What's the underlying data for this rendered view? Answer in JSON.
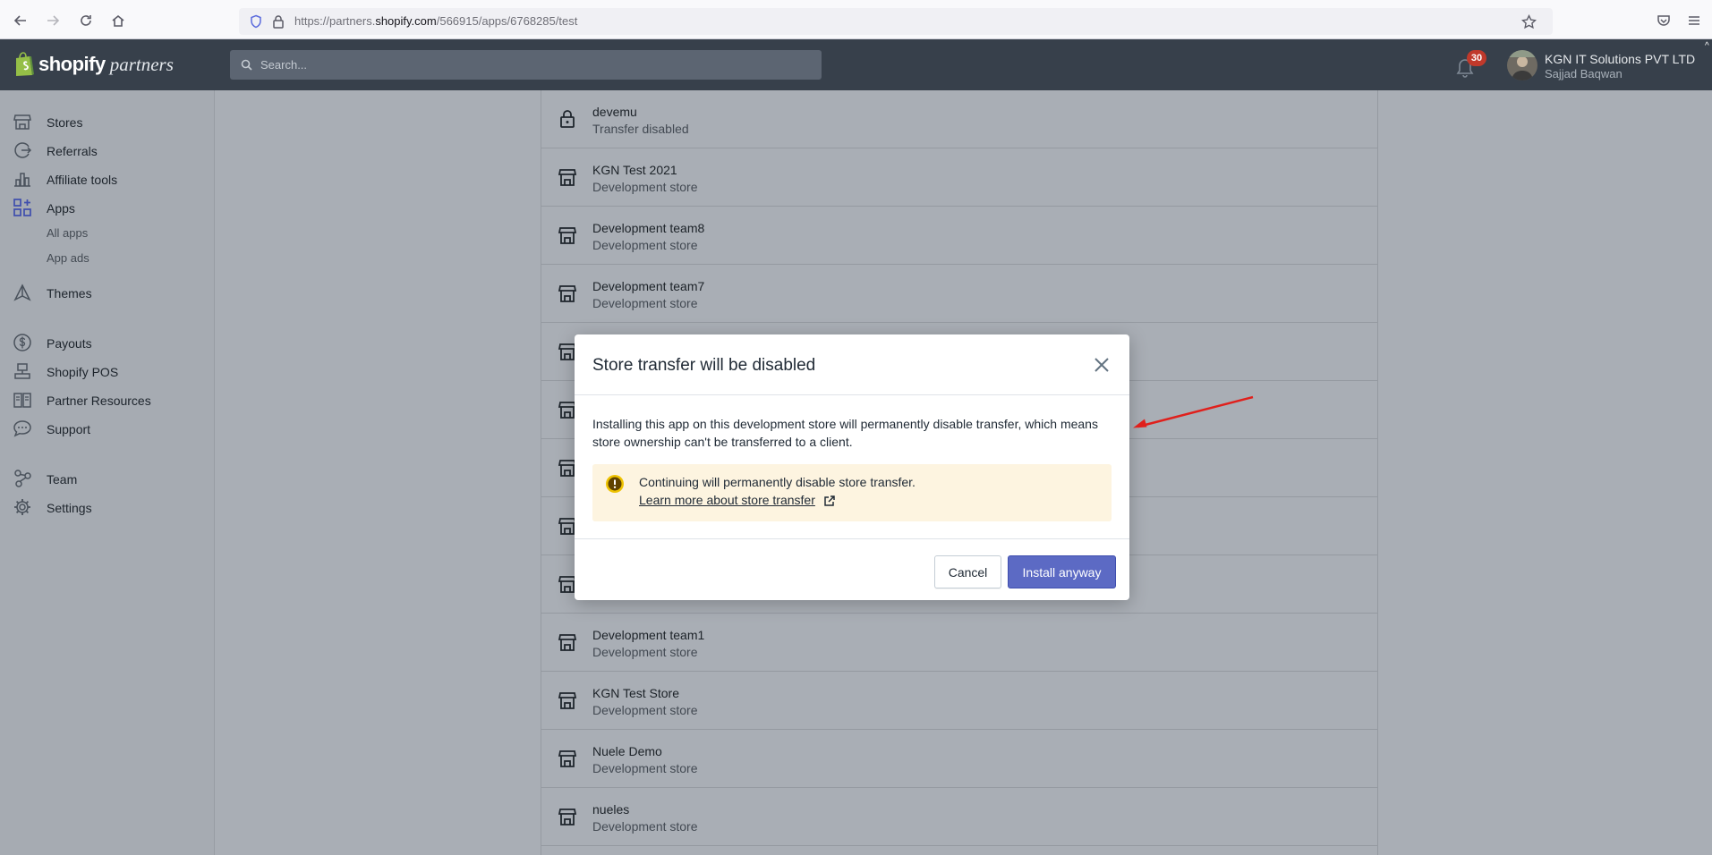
{
  "browser": {
    "url_prefix": "https://partners.",
    "url_host": "shopify.com",
    "url_path": "/566915/apps/6768285/test"
  },
  "header": {
    "logo_word1": "shopify",
    "logo_word2": "partners",
    "search_placeholder": "Search...",
    "notification_count": "30",
    "account_name": "KGN IT Solutions PVT LTD",
    "account_user": "Sajjad Baqwan"
  },
  "sidebar": {
    "items": [
      {
        "label": "Stores",
        "icon": "store-icon"
      },
      {
        "label": "Referrals",
        "icon": "referrals-icon"
      },
      {
        "label": "Affiliate tools",
        "icon": "chart-icon"
      },
      {
        "label": "Apps",
        "icon": "apps-icon"
      },
      {
        "label": "Themes",
        "icon": "themes-icon"
      },
      {
        "label": "Payouts",
        "icon": "dollar-icon"
      },
      {
        "label": "Shopify POS",
        "icon": "pos-icon"
      },
      {
        "label": "Partner Resources",
        "icon": "book-icon"
      },
      {
        "label": "Support",
        "icon": "chat-icon"
      },
      {
        "label": "Team",
        "icon": "team-icon"
      },
      {
        "label": "Settings",
        "icon": "gear-icon"
      }
    ],
    "sub_items": [
      "All apps",
      "App ads"
    ]
  },
  "stores": [
    {
      "name": "devemu",
      "status": "Transfer disabled",
      "icon": "lock-icon"
    },
    {
      "name": "KGN Test 2021",
      "status": "Development store",
      "icon": "store-icon"
    },
    {
      "name": "Development team8",
      "status": "Development store",
      "icon": "store-icon"
    },
    {
      "name": "Development team7",
      "status": "Development store",
      "icon": "store-icon"
    },
    {
      "name": "",
      "status": "",
      "icon": "store-icon"
    },
    {
      "name": "",
      "status": "",
      "icon": "store-icon"
    },
    {
      "name": "",
      "status": "",
      "icon": "store-icon"
    },
    {
      "name": "",
      "status": "",
      "icon": "store-icon"
    },
    {
      "name": "",
      "status": "",
      "icon": "store-icon"
    },
    {
      "name": "Development team1",
      "status": "Development store",
      "icon": "store-icon"
    },
    {
      "name": "KGN Test Store",
      "status": "Development store",
      "icon": "store-icon"
    },
    {
      "name": "Nuele Demo",
      "status": "Development store",
      "icon": "store-icon"
    },
    {
      "name": "nueles",
      "status": "Development store",
      "icon": "store-icon"
    }
  ],
  "modal": {
    "title": "Store transfer will be disabled",
    "body": "Installing this app on this development store will permanently disable transfer, which means store ownership can't be transferred to a client.",
    "banner_text": "Continuing will permanently disable store transfer.",
    "banner_link": "Learn more about store transfer",
    "cancel_label": "Cancel",
    "install_label": "Install anyway"
  },
  "colors": {
    "topbar": "#37404b",
    "primary_button": "#5c6ac4",
    "badge": "#c0392b",
    "annotation_arrow": "#e0201c",
    "warning_banner": "#fdf4e0"
  }
}
